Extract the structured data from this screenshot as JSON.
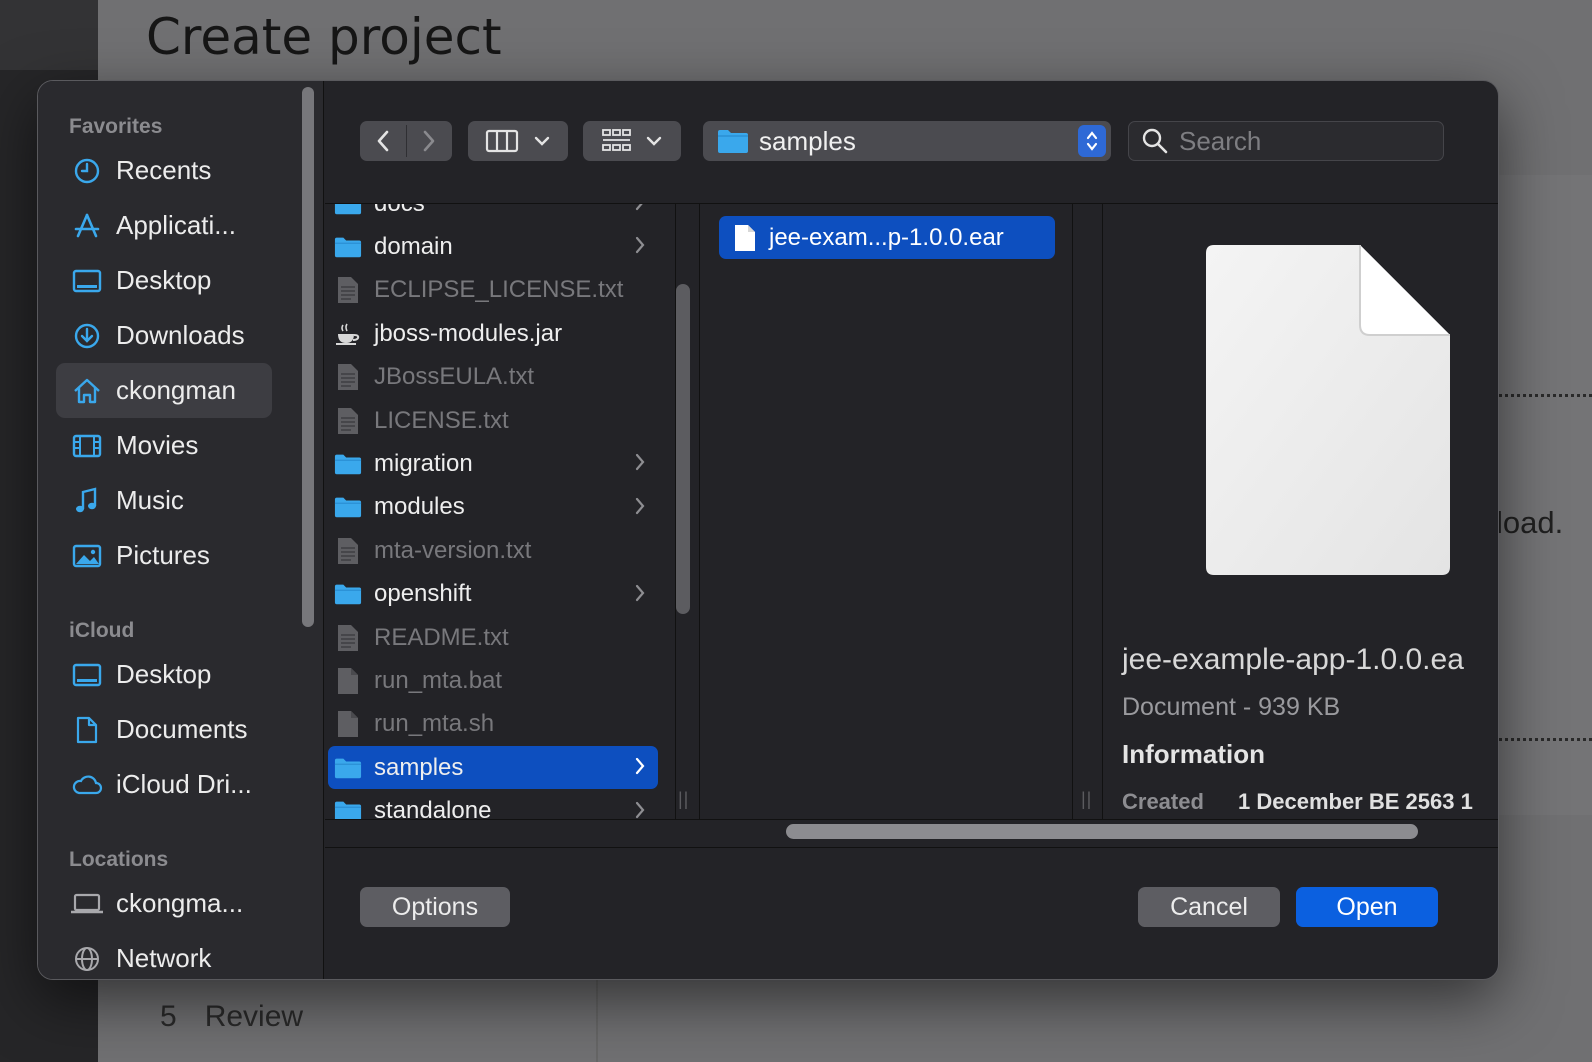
{
  "background": {
    "title": "Create project",
    "side_text": "load.",
    "step_number": "5",
    "step_label": "Review"
  },
  "toolbar": {
    "back_icon": "chevron-left-icon",
    "forward_icon": "chevron-right-icon",
    "view_mode_icon": "column-view-icon",
    "group_icon": "grid-icon",
    "path_label": "samples",
    "search_placeholder": "Search"
  },
  "sidebar": {
    "favorites_label": "Favorites",
    "favorites": [
      {
        "label": "Recents",
        "icon": "clock-icon"
      },
      {
        "label": "Applicati...",
        "icon": "applications-icon"
      },
      {
        "label": "Desktop",
        "icon": "desktop-icon"
      },
      {
        "label": "Downloads",
        "icon": "downloads-icon"
      },
      {
        "label": "ckongman",
        "icon": "home-icon"
      },
      {
        "label": "Movies",
        "icon": "film-icon"
      },
      {
        "label": "Music",
        "icon": "music-note-icon"
      },
      {
        "label": "Pictures",
        "icon": "pictures-icon"
      }
    ],
    "icloud_label": "iCloud",
    "icloud": [
      {
        "label": "Desktop",
        "icon": "desktop-icon"
      },
      {
        "label": "Documents",
        "icon": "document-icon"
      },
      {
        "label": "iCloud Dri...",
        "icon": "cloud-icon"
      }
    ],
    "locations_label": "Locations",
    "locations": [
      {
        "label": "ckongma...",
        "icon": "laptop-icon"
      },
      {
        "label": "Network",
        "icon": "network-icon"
      }
    ]
  },
  "column1": [
    {
      "name": "docs",
      "kind": "folder"
    },
    {
      "name": "domain",
      "kind": "folder"
    },
    {
      "name": "ECLIPSE_LICENSE.txt",
      "kind": "text"
    },
    {
      "name": "jboss-modules.jar",
      "kind": "jar"
    },
    {
      "name": "JBossEULA.txt",
      "kind": "text"
    },
    {
      "name": "LICENSE.txt",
      "kind": "text"
    },
    {
      "name": "migration",
      "kind": "folder"
    },
    {
      "name": "modules",
      "kind": "folder"
    },
    {
      "name": "mta-version.txt",
      "kind": "text"
    },
    {
      "name": "openshift",
      "kind": "folder"
    },
    {
      "name": "README.txt",
      "kind": "text"
    },
    {
      "name": "run_mta.bat",
      "kind": "file"
    },
    {
      "name": "run_mta.sh",
      "kind": "file"
    },
    {
      "name": "samples",
      "kind": "folder"
    },
    {
      "name": "standalone",
      "kind": "folder"
    }
  ],
  "column2": [
    {
      "name": "jee-exam...p-1.0.0.ear"
    }
  ],
  "preview": {
    "name": "jee-example-app-1.0.0.ea",
    "type_size": "Document - 939 KB",
    "info_heading": "Information",
    "created_label": "Created",
    "created_value": "1 December BE 2563 1"
  },
  "buttons": {
    "options": "Options",
    "cancel": "Cancel",
    "open": "Open"
  },
  "colors": {
    "selection": "#0d4fbf",
    "primary": "#0b60e0",
    "folder": "#3aa8ec"
  }
}
